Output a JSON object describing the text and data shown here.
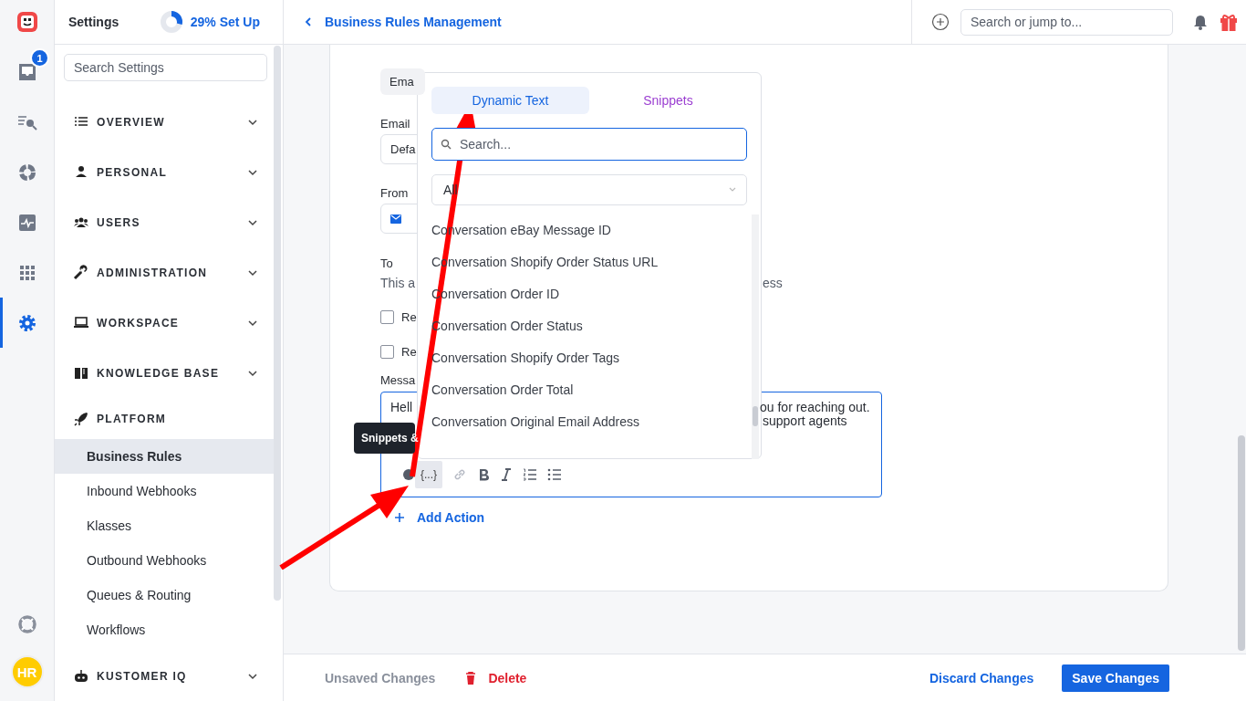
{
  "rail": {
    "items": [
      {
        "kind": "inbox",
        "selected": false,
        "badge": "1"
      },
      {
        "kind": "search-list",
        "selected": false
      },
      {
        "kind": "ring",
        "selected": false
      },
      {
        "kind": "pulse",
        "selected": false
      },
      {
        "kind": "grid",
        "selected": false
      },
      {
        "kind": "gear",
        "selected": true
      }
    ],
    "bottom": [
      {
        "kind": "lifebuoy"
      },
      {
        "kind": "avatar",
        "initials": "HR"
      }
    ]
  },
  "settings": {
    "title": "Settings",
    "setup": {
      "label": "29% Set Up",
      "level": 0.29
    },
    "search": {
      "placeholder": "Search Settings"
    },
    "sections": [
      {
        "label": "OVERVIEW",
        "kind": "list",
        "expanded": false
      },
      {
        "label": "PERSONAL",
        "kind": "person",
        "expanded": false
      },
      {
        "label": "USERS",
        "kind": "users",
        "expanded": false
      },
      {
        "label": "ADMINISTRATION",
        "kind": "wrench",
        "expanded": false
      },
      {
        "label": "WORKSPACE",
        "kind": "laptop",
        "expanded": false
      },
      {
        "label": "KNOWLEDGE BASE",
        "kind": "book",
        "expanded": false
      },
      {
        "label": "PLATFORM",
        "kind": "rocket",
        "expanded": true,
        "children": [
          {
            "label": "Business Rules",
            "selected": true
          },
          {
            "label": "Inbound Webhooks",
            "selected": false
          },
          {
            "label": "Klasses",
            "selected": false
          },
          {
            "label": "Outbound Webhooks",
            "selected": false
          },
          {
            "label": "Queues & Routing",
            "selected": false
          },
          {
            "label": "Workflows",
            "selected": false
          }
        ]
      },
      {
        "label": "KUSTOMER IQ",
        "kind": "robot",
        "expanded": false
      }
    ]
  },
  "header": {
    "title": "Business Rules Management",
    "search": {
      "placeholder": "Search or jump to..."
    }
  },
  "form": {
    "chip": "Ema",
    "email_label": "Email",
    "email_value": "Defa",
    "from_label": "From",
    "to_label": "To",
    "to_desc_left": "This a",
    "to_desc_right": "ess",
    "checkboxes": [
      {
        "label": "Re",
        "checked": false
      },
      {
        "label": "Re",
        "checked": false
      }
    ],
    "message_label": "Messa",
    "message_lines": [
      {
        "left": "Hell",
        "right": "ou for reaching out."
      },
      {
        "right": "support agents"
      }
    ],
    "tooltip": "Snippets &",
    "snippet_button": "{...}",
    "add_action": "Add Action"
  },
  "popover": {
    "tabs": [
      {
        "label": "Dynamic Text",
        "selected": true
      },
      {
        "label": "Snippets",
        "selected": false
      }
    ],
    "search": {
      "placeholder": "Search..."
    },
    "filter": "All",
    "items": [
      "Conversation eBay Message ID",
      "Conversation Shopify Order Status URL",
      "Conversation Order ID",
      "Conversation Order Status",
      "Conversation Shopify Order Tags",
      "Conversation Order Total",
      "Conversation Original Email Address"
    ]
  },
  "footer": {
    "status": "Unsaved Changes",
    "delete": "Delete",
    "discard": "Discard Changes",
    "save": "Save Changes"
  }
}
